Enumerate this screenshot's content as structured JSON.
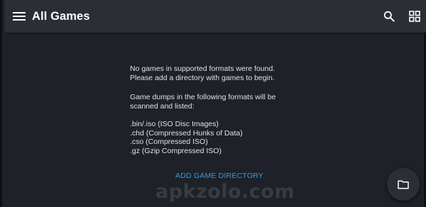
{
  "app_bar": {
    "title": "All Games",
    "icons": {
      "menu": "hamburger-menu-icon",
      "search": "search-icon",
      "view_toggle": "grid-view-icon"
    }
  },
  "empty_state": {
    "line1": "No games in supported formats were found.",
    "line2": "Please add a directory with games to begin.",
    "line3": "Game dumps in the following formats will be",
    "line4": "scanned and listed:",
    "formats": [
      ".bin/.iso (ISO Disc Images)",
      ".chd (Compressed Hunks of Data)",
      ".cso (Compressed ISO)",
      ".gz (Gzip Compressed ISO)"
    ],
    "action_label": "ADD GAME DIRECTORY"
  },
  "fab": {
    "icon": "folder-icon"
  },
  "watermark": "apkzolo.com",
  "colors": {
    "background": "#1e2128",
    "app_bar": "#2b2e35",
    "text": "#dfe1e5",
    "accent": "#2d9ee8"
  }
}
